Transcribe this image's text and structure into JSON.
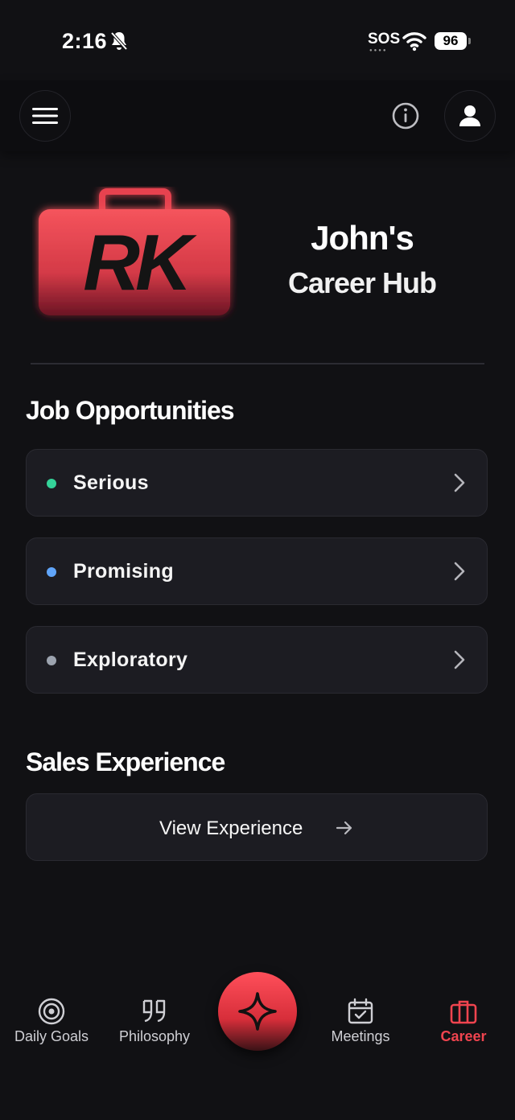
{
  "status_bar": {
    "time": "2:16",
    "carrier": "SOS",
    "battery": "96",
    "icons": [
      "bell-slash-icon",
      "wifi-icon",
      "battery-icon"
    ]
  },
  "header": {
    "menu_icon": "hamburger-menu-icon",
    "info_icon": "info-icon",
    "profile_icon": "user-icon"
  },
  "hero": {
    "logo_text": "RK",
    "title_line1": "John's",
    "title_line2": "Career Hub"
  },
  "job_section": {
    "title": "Job Opportunities",
    "items": [
      {
        "label": "Serious",
        "dot_color": "#34d399"
      },
      {
        "label": "Promising",
        "dot_color": "#60a5fa"
      },
      {
        "label": "Exploratory",
        "dot_color": "#9ca3af"
      }
    ]
  },
  "sales_section": {
    "title": "Sales Experience",
    "button_label": "View Experience"
  },
  "bottom_nav": {
    "items": [
      {
        "label": "Daily Goals",
        "icon": "target-icon"
      },
      {
        "label": "Philosophy",
        "icon": "quote-icon"
      },
      {
        "label": "Meetings",
        "icon": "calendar-check-icon"
      },
      {
        "label": "Career",
        "icon": "briefcase-icon",
        "active": true
      }
    ],
    "fab_icon": "sparkle-icon"
  },
  "colors": {
    "background": "#111114",
    "accent": "#f0444f",
    "card": "#1c1c22"
  }
}
